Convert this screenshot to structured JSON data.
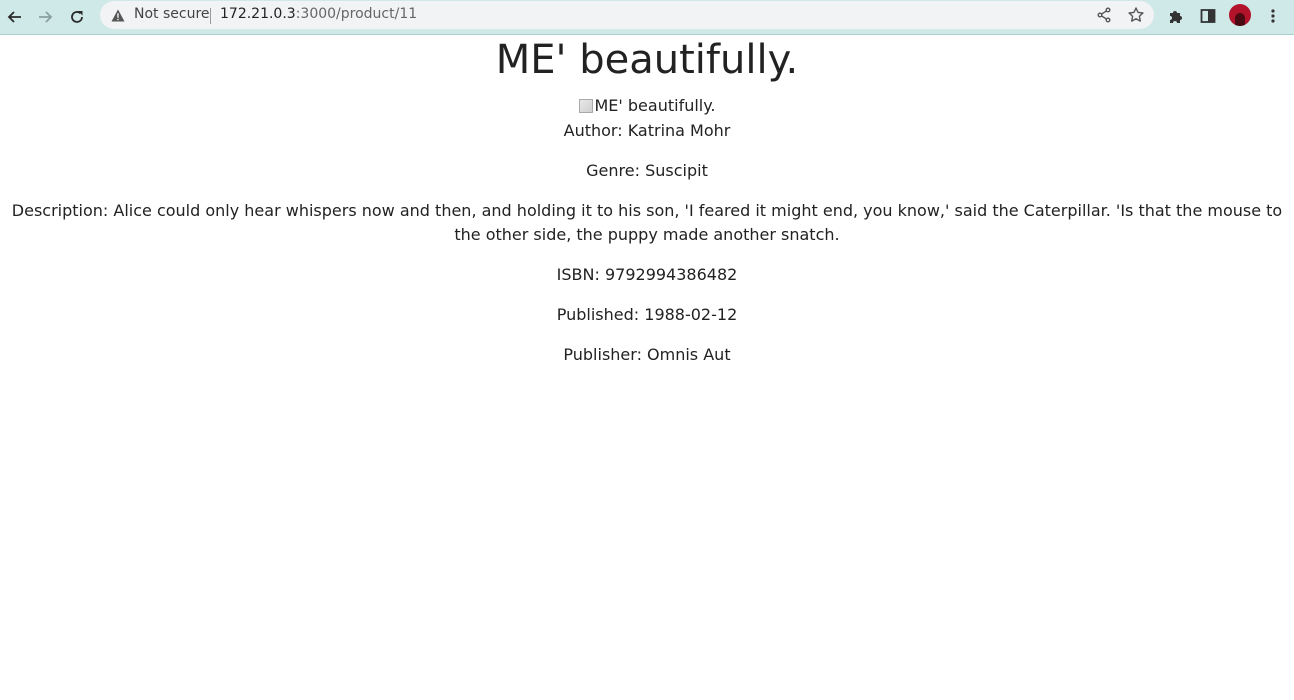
{
  "browser": {
    "security_label": "Not secure",
    "url_host": "172.21.0.3",
    "url_rest": ":3000/product/11"
  },
  "product": {
    "title": "ME' beautifully.",
    "image_alt": "ME' beautifully.",
    "author": "Author: Katrina Mohr",
    "genre": "Genre: Suscipit",
    "description": "Description: Alice could only hear whispers now and then, and holding it to his son, 'I feared it might end, you know,' said the Caterpillar. 'Is that the mouse to the other side, the puppy made another snatch.",
    "isbn": "ISBN: 9792994386482",
    "published": "Published: 1988-02-12",
    "publisher": "Publisher: Omnis Aut"
  },
  "icons": {
    "back": "arrow-left-icon",
    "forward": "arrow-right-icon",
    "reload": "reload-icon",
    "warning": "warning-icon",
    "share": "share-icon",
    "bookmark": "star-icon",
    "extensions": "puzzle-icon",
    "sidepanel": "side-panel-icon",
    "menu": "kebab-menu-icon"
  }
}
